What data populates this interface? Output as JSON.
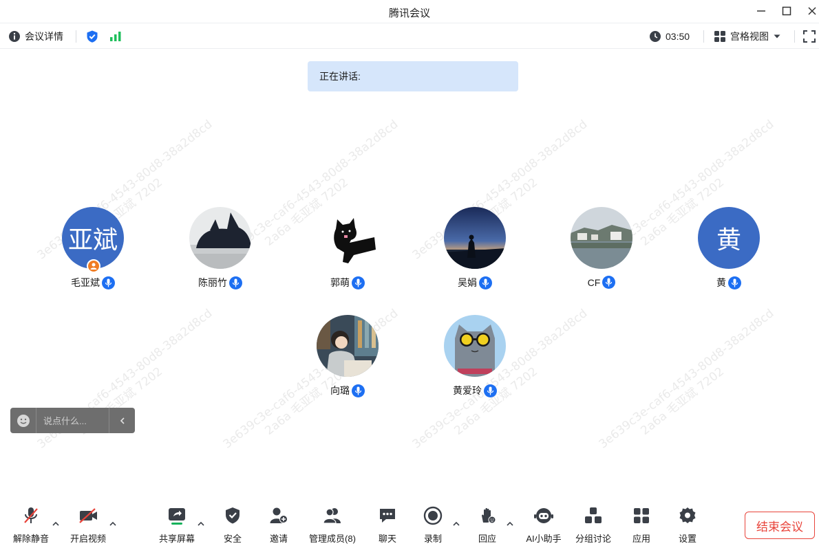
{
  "window": {
    "title": "腾讯会议"
  },
  "infobar": {
    "meeting_details": "会议详情",
    "timer": "03:50",
    "view_mode": "宫格视图"
  },
  "speaking": {
    "label": "正在讲话:"
  },
  "participants": [
    {
      "name": "毛亚斌",
      "avatar_text": "亚斌",
      "avatar_type": "text",
      "host": true
    },
    {
      "name": "陈丽竹",
      "avatar_type": "photo-cat"
    },
    {
      "name": "郭萌",
      "avatar_type": "photo-black-cat"
    },
    {
      "name": "吴娟",
      "avatar_type": "photo-sunset"
    },
    {
      "name": "CF",
      "avatar_type": "photo-landscape"
    },
    {
      "name": "黄",
      "avatar_text": "黄",
      "avatar_type": "text"
    },
    {
      "name": "向璐",
      "avatar_type": "photo-girl"
    },
    {
      "name": "黄爱玲",
      "avatar_type": "photo-cartoon-cat"
    }
  ],
  "watermark": {
    "line1": "3e639c3e-caf6-4543-80d8-38a2d8cd",
    "line2": "2a6a 毛亚斌 7202"
  },
  "chat": {
    "placeholder": "说点什么..."
  },
  "toolbar": {
    "unmute": "解除静音",
    "start_video": "开启视频",
    "share_screen": "共享屏幕",
    "security": "安全",
    "invite": "邀请",
    "manage_members": "管理成员(8)",
    "chat": "聊天",
    "record": "录制",
    "react": "回应",
    "ai_assistant": "AI小助手",
    "breakout": "分组讨论",
    "apps": "应用",
    "settings": "设置",
    "end_meeting": "结束会议"
  },
  "colors": {
    "accent": "#1d6ff2",
    "avatar_blue": "#3b6bc4",
    "end_red": "#e8433a",
    "signal_green": "#1fbf5c",
    "share_green": "#13b15a",
    "speaking_bg": "#d6e6fb"
  }
}
